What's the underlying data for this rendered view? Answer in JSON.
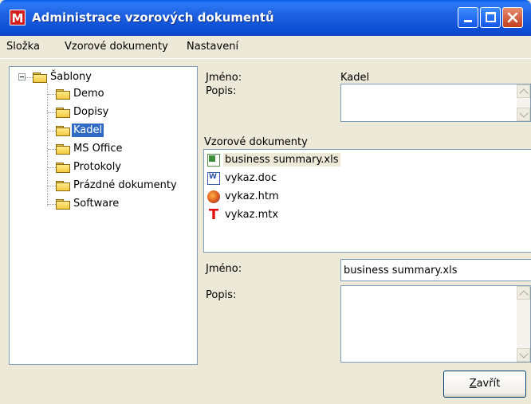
{
  "window": {
    "title": "Administrace vzorových dokumentů",
    "app_icon_letter": "M",
    "buttons": {
      "minimize": "minimize-icon",
      "maximize": "maximize-icon",
      "close": "close-icon"
    }
  },
  "menu": [
    "Složka",
    "Vzorové dokumenty",
    "Nastavení"
  ],
  "tree": {
    "root": "Šablony",
    "items": [
      "Demo",
      "Dopisy",
      "Kadel",
      "MS Office",
      "Protokoly",
      "Prázdné dokumenty",
      "Software"
    ],
    "selected": "Kadel"
  },
  "folder": {
    "name_label": "Jméno:",
    "name_value": "Kadel",
    "desc_label": "Popis:",
    "desc_value": ""
  },
  "documents": {
    "label": "Vzorové dokumenty",
    "items": [
      {
        "name": "business summary.xls",
        "icon": "excel-file-icon"
      },
      {
        "name": "vykaz.doc",
        "icon": "word-file-icon"
      },
      {
        "name": "vykaz.htm",
        "icon": "html-file-icon"
      },
      {
        "name": "vykaz.mtx",
        "icon": "mtx-file-icon"
      }
    ],
    "focused": "business summary.xls"
  },
  "document_detail": {
    "name_label": "Jméno:",
    "name_value": "business summary.xls",
    "desc_label": "Popis:",
    "desc_value": ""
  },
  "footer": {
    "close_prefix": "",
    "close_accel": "Z",
    "close_rest": "avřít"
  },
  "colors": {
    "titlebar": "#0A5BE6",
    "selection": "#316AC5",
    "face": "#ECE9D8",
    "border": "#7F9DB9"
  }
}
